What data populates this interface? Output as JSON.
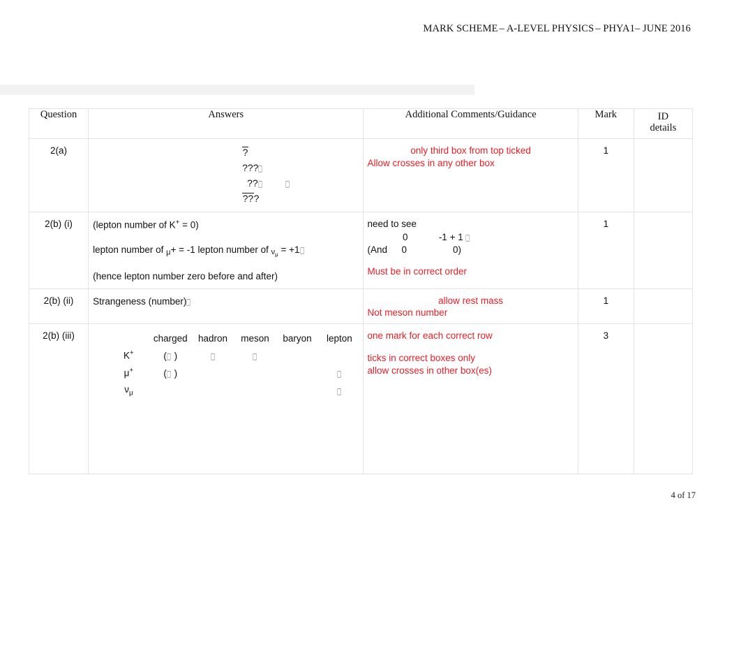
{
  "header": {
    "part1": "MARK SCHEME",
    "part2": "– A-LEVEL PHYSICS",
    "part3": "– PHYA1",
    "part4": "– JUNE 2016"
  },
  "table": {
    "columns": {
      "question": "Question",
      "answers": "Answers",
      "guidance": "Additional Comments/Guidance",
      "mark": "Mark",
      "id_line1": "ID",
      "id_line2": "details"
    },
    "rows": [
      {
        "question": "2(a)",
        "equation_lines": [
          {
            "overline": "?",
            "rest": ""
          },
          {
            "overline": "",
            "rest": "???"
          },
          {
            "overline": "",
            "rest": "??"
          },
          {
            "overline": "??",
            "rest": "?"
          }
        ],
        "guidance_red": [
          "only third  box from top ticked",
          "Allow crosses in any other box"
        ],
        "mark": "1"
      },
      {
        "question": "2(b) (i)",
        "answer_lines": [
          "(lepton number of K+ = 0)",
          "lepton number of μ+ = -1 lepton number of νμ = +1",
          "(hence lepton number zero before and after)"
        ],
        "guidance_black_intro": "need to see",
        "guidance_numbers": [
          {
            "left": "",
            "c1": "0",
            "c2": "-1 + 1"
          },
          {
            "left": "(And",
            "c1": "0",
            "c2": "0)"
          }
        ],
        "guidance_red": [
          "Must be in correct order"
        ],
        "mark": "1"
      },
      {
        "question": "2(b) (ii)",
        "answer_text": "Strangeness (number)",
        "guidance_red": [
          "allow rest mass",
          "Not meson number"
        ],
        "mark": "1"
      },
      {
        "question": "2(b) (iii)",
        "particle_table": {
          "headers": [
            "charged",
            "hadron",
            "meson",
            "baryon",
            "lepton"
          ],
          "rows": [
            {
              "label": "K+",
              "cells": [
                "(tick)",
                "tick",
                "tick",
                "",
                ""
              ]
            },
            {
              "label": "μ+",
              "cells": [
                "(tick)",
                "",
                "",
                "",
                "tick"
              ]
            },
            {
              "label": "νμ",
              "cells": [
                "",
                "",
                "",
                "",
                "tick"
              ]
            }
          ]
        },
        "guidance_red": [
          "one mark for each correct row",
          "ticks in correct boxes only",
          "allow crosses in other box(es)"
        ],
        "mark": "3"
      }
    ]
  },
  "footer": {
    "page_number": "4 of 17"
  }
}
